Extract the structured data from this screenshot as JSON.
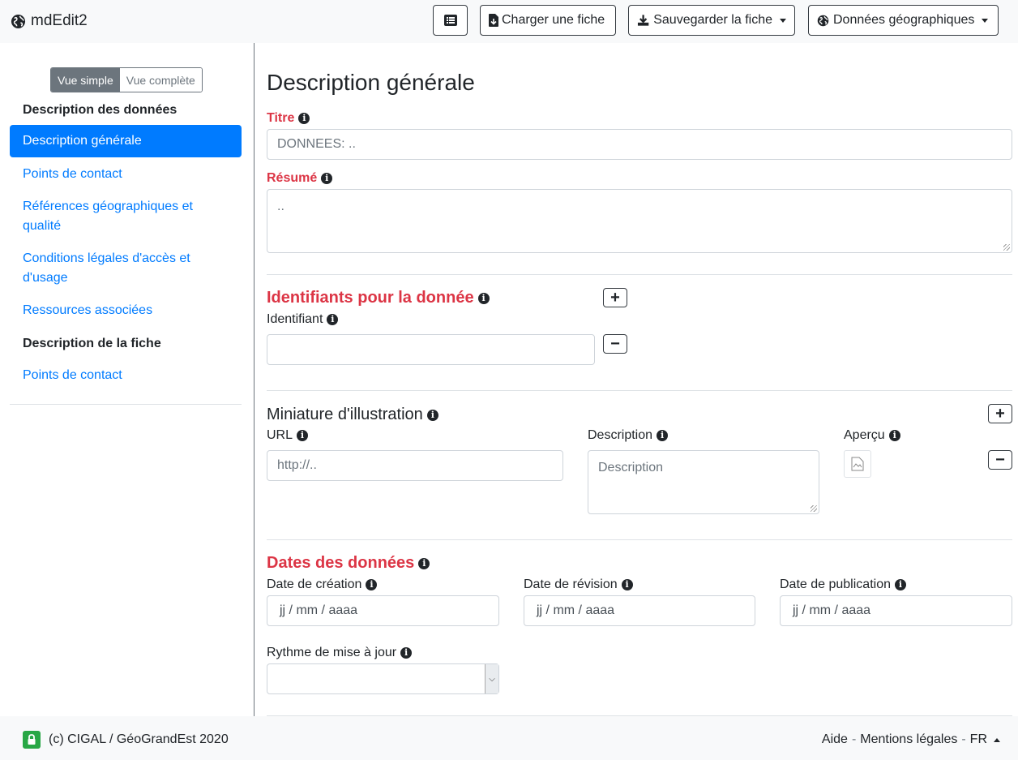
{
  "navbar": {
    "brand": "mdEdit2",
    "list_icon": "list-icon",
    "load_label": "Charger une fiche",
    "save_label": "Sauvegarder la fiche",
    "geo_label": "Données géographiques"
  },
  "sidebar": {
    "view_simple": "Vue simple",
    "view_full": "Vue complète",
    "section_data": "Description des données",
    "items": [
      {
        "label": "Description générale",
        "active": true
      },
      {
        "label": "Points de contact"
      },
      {
        "label": "Références géographiques et qualité"
      },
      {
        "label": "Conditions légales d'accès et d'usage"
      },
      {
        "label": "Ressources associées"
      }
    ],
    "section_record": "Description de la fiche",
    "record_items": [
      {
        "label": "Points de contact"
      }
    ]
  },
  "main": {
    "title": "Description générale",
    "titre_label": "Titre",
    "titre_placeholder": "DONNEES: ..",
    "resume_label": "Résumé",
    "resume_placeholder": "..",
    "identifiants_title": "Identifiants pour la donnée",
    "identifiant_label": "Identifiant",
    "miniature_title": "Miniature d'illustration",
    "url_label": "URL",
    "url_placeholder": "http://..",
    "description_label": "Description",
    "description_placeholder": "Description",
    "apercu_label": "Aperçu",
    "dates_title": "Dates des données",
    "date_creation_label": "Date de création",
    "date_revision_label": "Date de révision",
    "date_publication_label": "Date de publication",
    "date_placeholder": "jj / mm / aaaa",
    "rythme_label": "Rythme de mise à jour",
    "rythme_value": ""
  },
  "footer": {
    "copyright": "(c) CIGAL / GéoGrandEst 2020",
    "aide": "Aide",
    "mentions": "Mentions légales",
    "lang": "FR",
    "separator": "-"
  },
  "colors": {
    "primary": "#007bff",
    "required": "#dc3545",
    "secondary": "#6c757d",
    "lock": "#28a745"
  }
}
